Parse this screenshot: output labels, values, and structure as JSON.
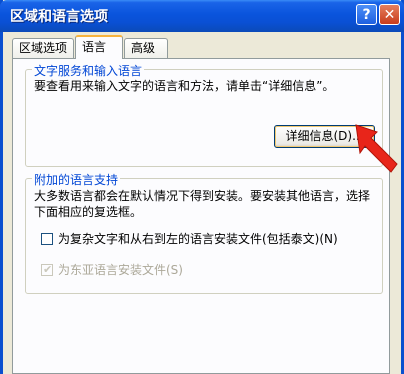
{
  "window": {
    "title": "区域和语言选项",
    "help_glyph": "?",
    "close_glyph": "✕"
  },
  "tabs": [
    {
      "label": "区域选项",
      "selected": false
    },
    {
      "label": "语言",
      "selected": true
    },
    {
      "label": "高级",
      "selected": false
    }
  ],
  "text_services": {
    "legend": "文字服务和输入语言",
    "description": "要查看用来输入文字的语言和方法，请单击“详细信息”。",
    "details_button": "详细信息(D)..."
  },
  "supplemental": {
    "legend": "附加的语言支持",
    "description_line1": "大多数语言都会在默认情况下得到安装。要安装其他语言，选择",
    "description_line2": "下面相应的复选框。",
    "complex_scripts": {
      "label": "为复杂文字和从右到左的语言安装文件(包括泰文)(N)",
      "checked": false,
      "enabled": true
    },
    "east_asian": {
      "label": "为东亚语言安装文件(S)",
      "checked": true,
      "enabled": false
    }
  },
  "colors": {
    "annotation_arrow": "#e8251a",
    "title_bar": "#0a54dc",
    "group_legend": "#0046d5"
  }
}
